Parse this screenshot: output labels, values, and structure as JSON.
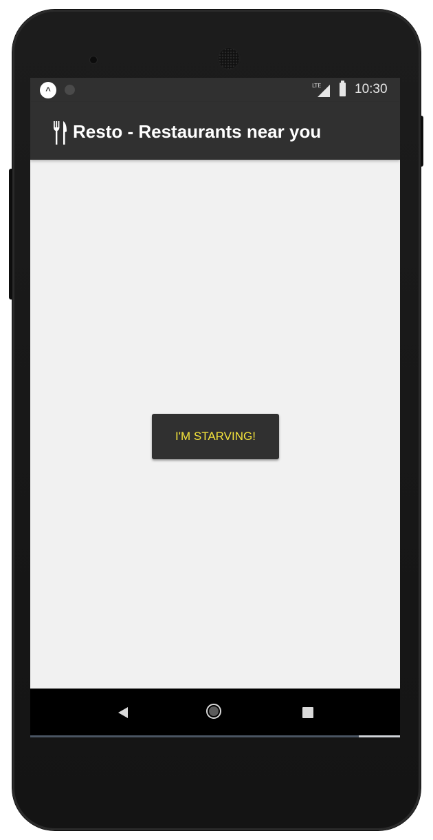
{
  "status_bar": {
    "network_label": "LTE",
    "time": "10:30",
    "logo_glyph": "^"
  },
  "app_bar": {
    "icon": "fork-knife-icon",
    "title": "Resto - Restaurants near you"
  },
  "main": {
    "button_label": "I'M STARVING!"
  },
  "nav_bar": {
    "back_icon": "back-triangle-icon",
    "home_icon": "home-circle-icon",
    "recents_icon": "recents-square-icon"
  },
  "colors": {
    "app_bar_bg": "#303030",
    "screen_bg": "#f1f1f1",
    "button_text": "#f5e43b",
    "nav_bar_bg": "#000000"
  }
}
